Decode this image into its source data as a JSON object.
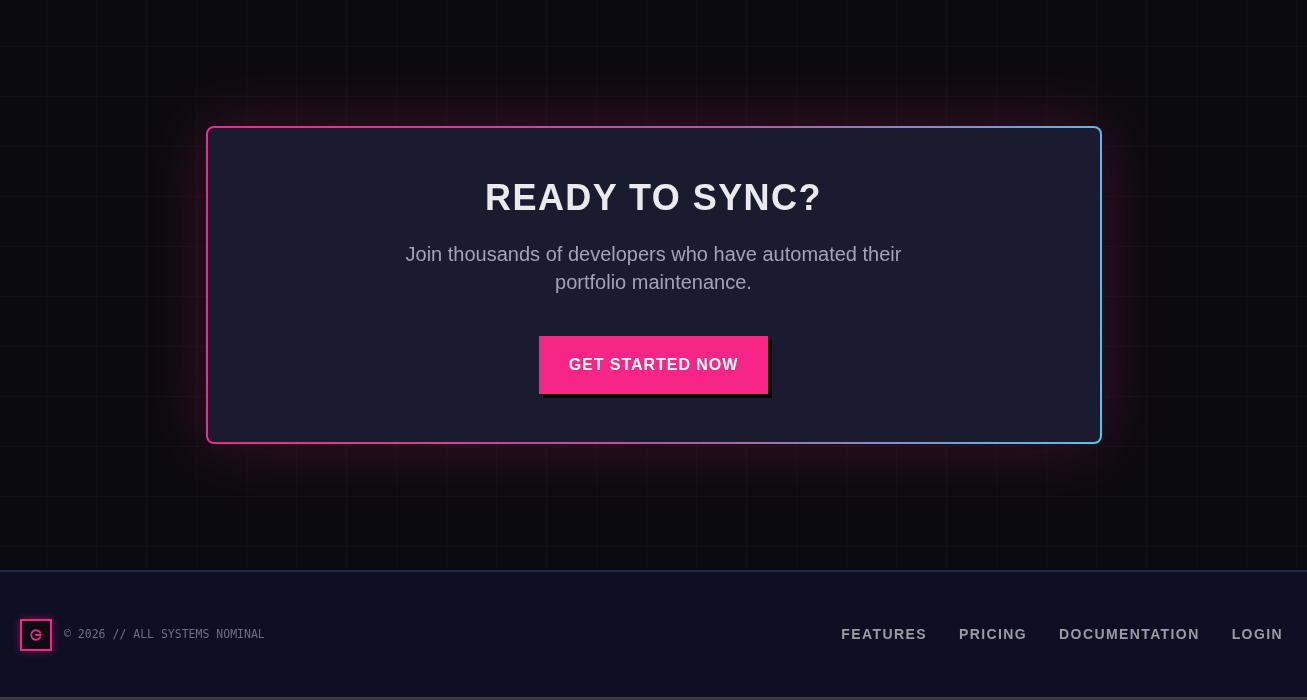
{
  "cta": {
    "title": "READY TO SYNC?",
    "description": "Join thousands of developers who have automated their portfolio maintenance.",
    "button": "GET STARTED NOW"
  },
  "footer": {
    "copyright": "© 2026 // ALL SYSTEMS NOMINAL",
    "links": [
      "FEATURES",
      "PRICING",
      "DOCUMENTATION",
      "LOGIN"
    ]
  }
}
